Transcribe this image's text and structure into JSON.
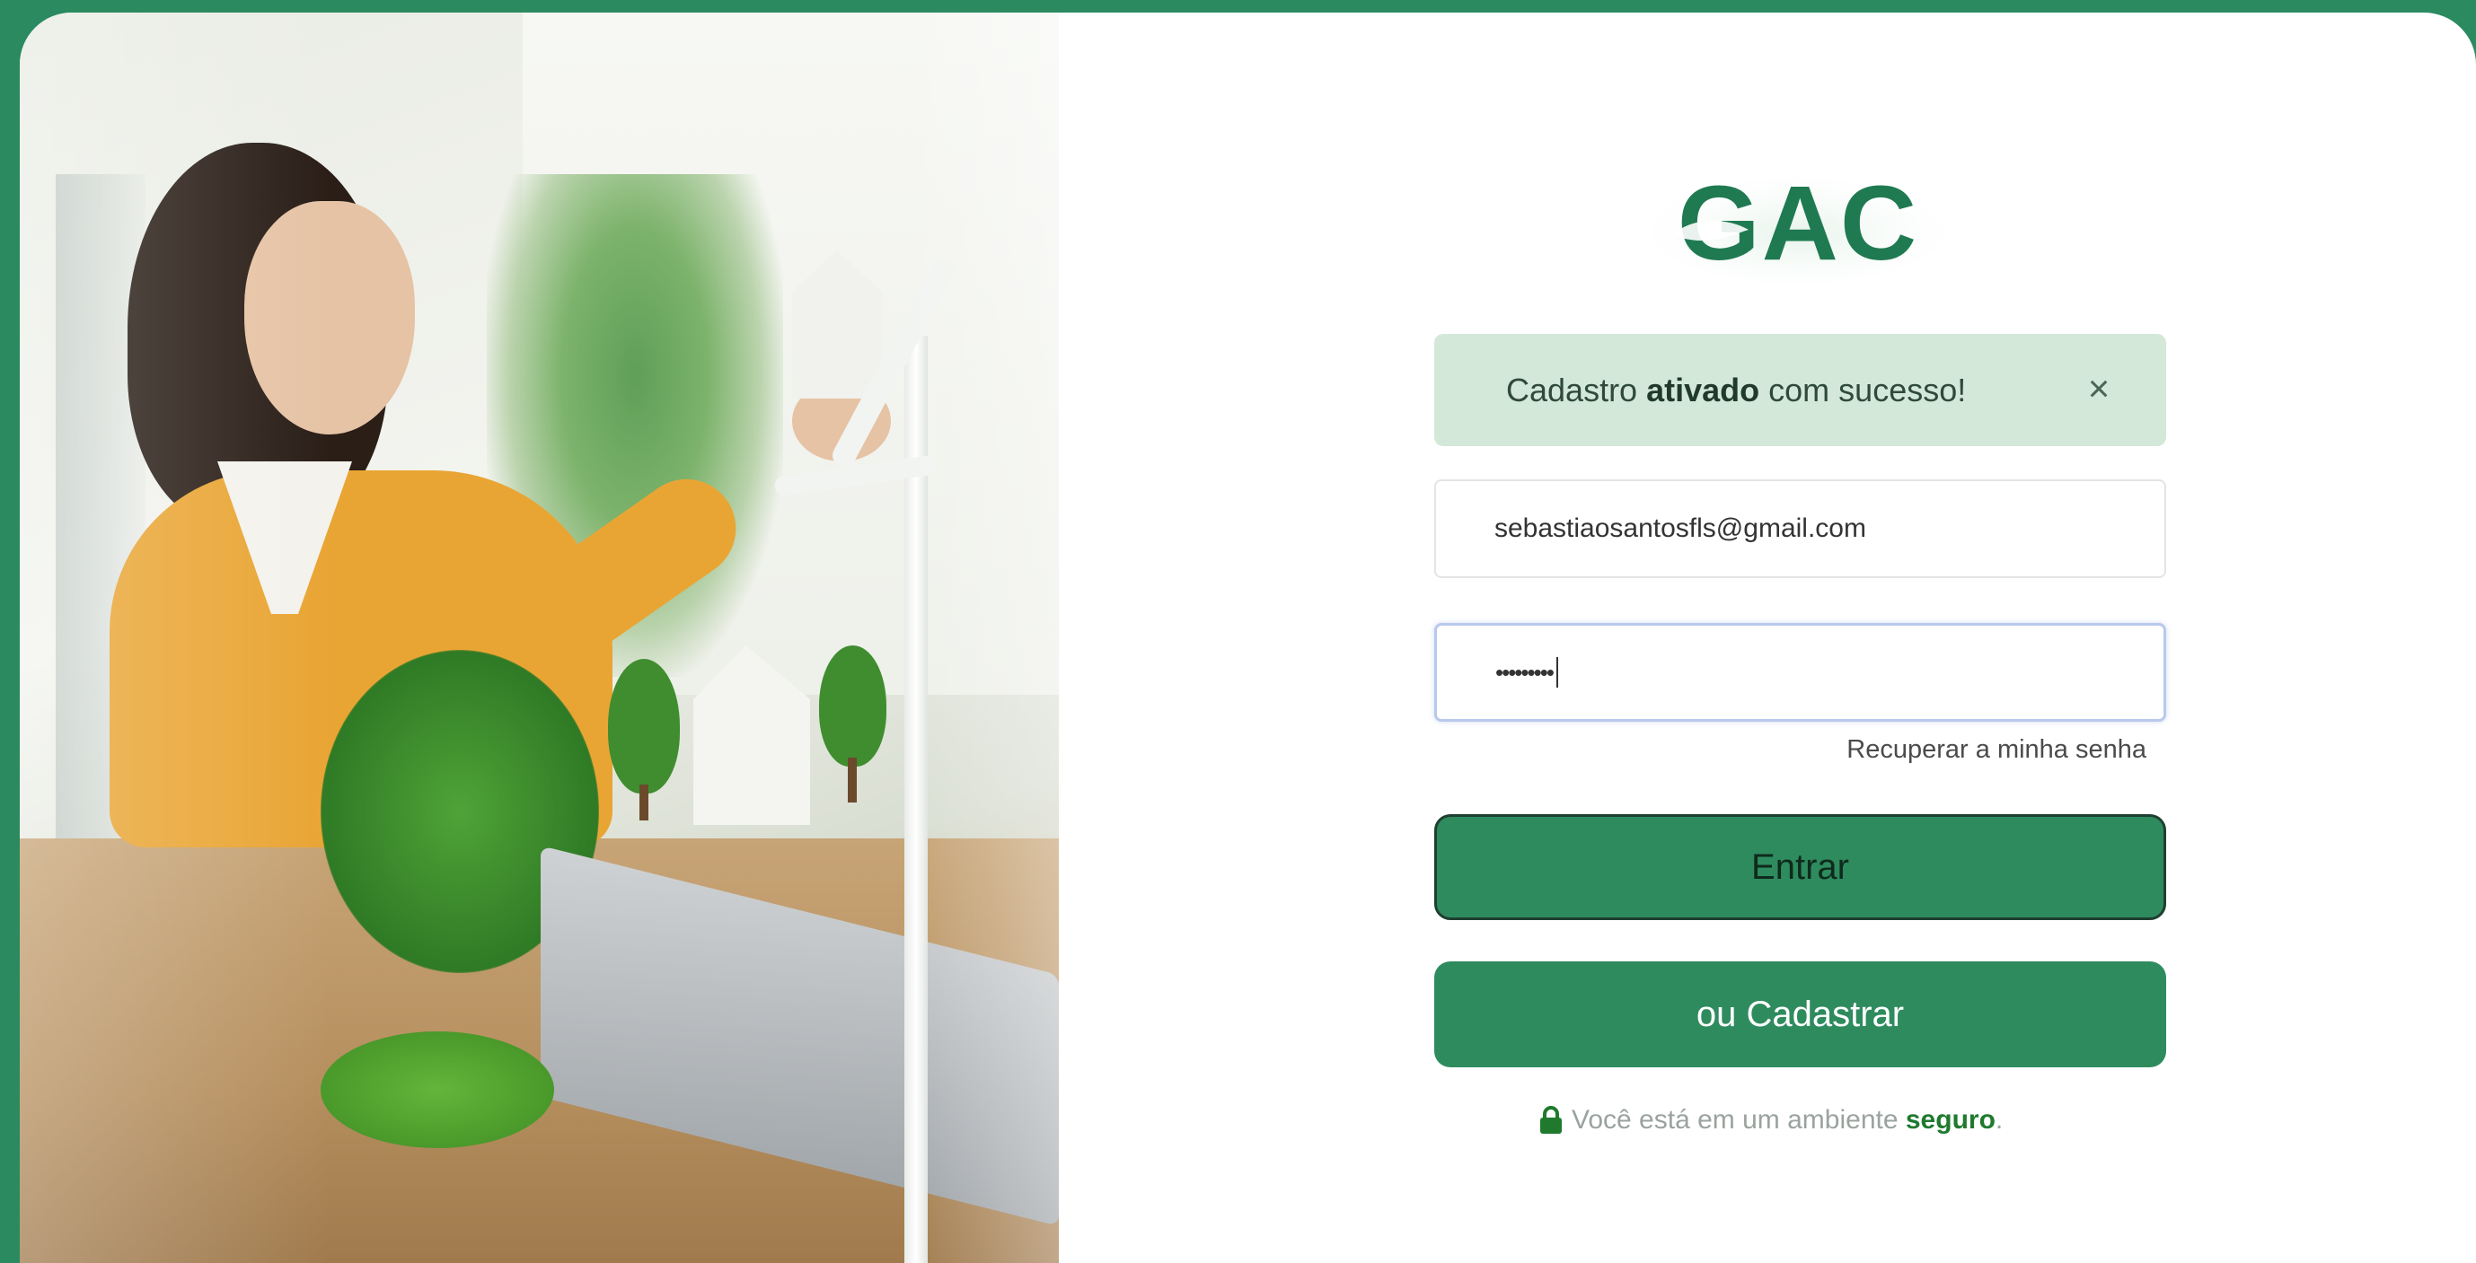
{
  "brand": {
    "logo_text": "GAC",
    "color_primary": "#2e8b5e",
    "color_dark": "#1f7a52"
  },
  "alert": {
    "prefix": "Cadastro",
    "emphasis": "ativado",
    "suffix": "com sucesso!",
    "close_icon": "close-icon",
    "close_glyph": "×"
  },
  "form": {
    "email_value": "sebastiaosantosfls@gmail.com",
    "password_value": "•••••••••",
    "recover_label": "Recuperar a minha senha",
    "enter_label": "Entrar",
    "signup_label": "ou Cadastrar"
  },
  "footer": {
    "secure_prefix": "Você está em um ambiente",
    "secure_emphasis": "seguro",
    "secure_suffix": ".",
    "lock_icon": "lock-icon"
  }
}
